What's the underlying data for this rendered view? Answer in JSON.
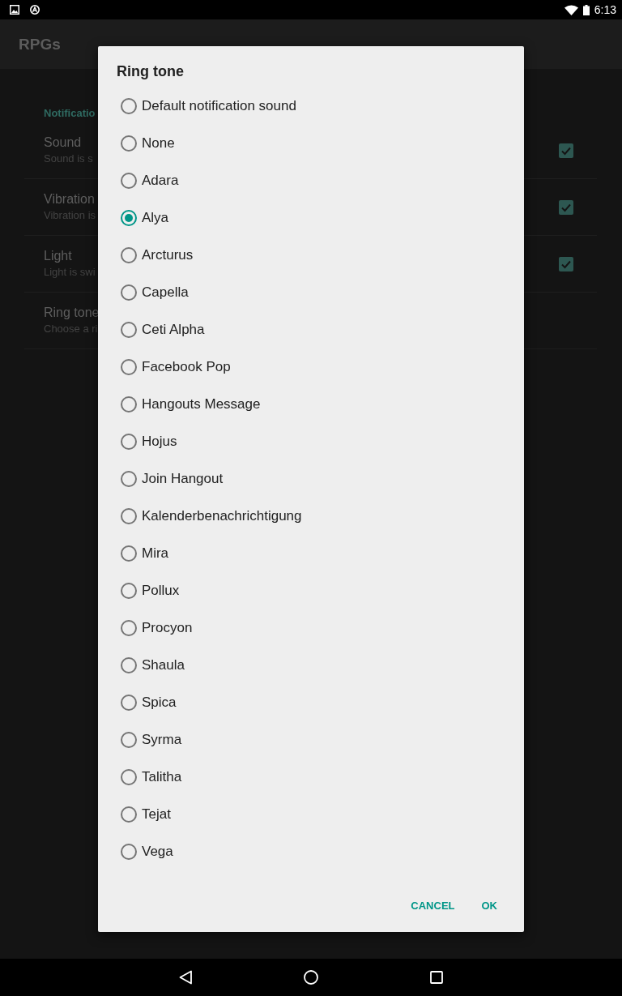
{
  "status_bar": {
    "time": "6:13"
  },
  "app_bar": {
    "title": "RPGs"
  },
  "settings": {
    "section_header": "Notificatio",
    "items": [
      {
        "title": "Sound",
        "summary": "Sound is s",
        "kind": "checkbox",
        "checked": true
      },
      {
        "title": "Vibration",
        "summary": "Vibration is",
        "kind": "checkbox",
        "checked": true
      },
      {
        "title": "Light",
        "summary": "Light is swi",
        "kind": "checkbox",
        "checked": true
      },
      {
        "title": "Ring tone",
        "summary": "Choose a ri",
        "kind": "plain"
      }
    ]
  },
  "dialog": {
    "title": "Ring tone",
    "options": [
      {
        "label": "Default notification sound",
        "selected": false
      },
      {
        "label": "None",
        "selected": false
      },
      {
        "label": "Adara",
        "selected": false
      },
      {
        "label": "Alya",
        "selected": true
      },
      {
        "label": "Arcturus",
        "selected": false
      },
      {
        "label": "Capella",
        "selected": false
      },
      {
        "label": "Ceti Alpha",
        "selected": false
      },
      {
        "label": "Facebook Pop",
        "selected": false
      },
      {
        "label": "Hangouts Message",
        "selected": false
      },
      {
        "label": "Hojus",
        "selected": false
      },
      {
        "label": "Join Hangout",
        "selected": false
      },
      {
        "label": "Kalenderbenachrichtigung",
        "selected": false
      },
      {
        "label": "Mira",
        "selected": false
      },
      {
        "label": "Pollux",
        "selected": false
      },
      {
        "label": "Procyon",
        "selected": false
      },
      {
        "label": "Shaula",
        "selected": false
      },
      {
        "label": "Spica",
        "selected": false
      },
      {
        "label": "Syrma",
        "selected": false
      },
      {
        "label": "Talitha",
        "selected": false
      },
      {
        "label": "Tejat",
        "selected": false
      },
      {
        "label": "Vega",
        "selected": false
      }
    ],
    "buttons": [
      {
        "label": "CANCEL"
      },
      {
        "label": "OK"
      }
    ]
  }
}
